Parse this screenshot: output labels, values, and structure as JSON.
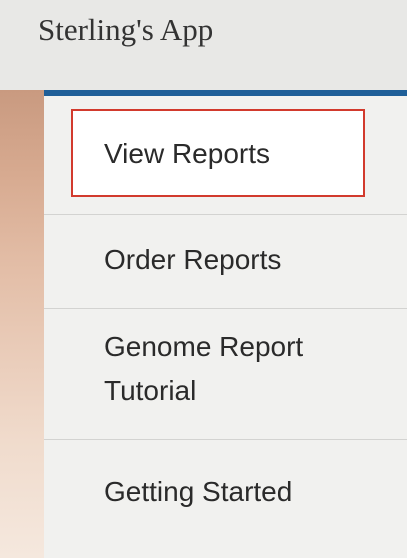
{
  "app": {
    "title": "Sterling's App"
  },
  "menu": {
    "accent_color": "#1f5f98",
    "highlight_color": "#d23a2d",
    "items": [
      {
        "label": "View Reports",
        "selected": true
      },
      {
        "label": "Order Reports",
        "selected": false
      },
      {
        "label": "Genome Report Tutorial",
        "selected": false
      },
      {
        "label": "Getting Started",
        "selected": false
      }
    ]
  }
}
